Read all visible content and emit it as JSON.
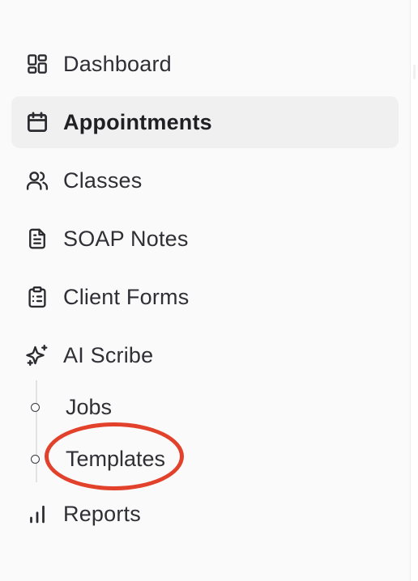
{
  "sidebar": {
    "items": [
      {
        "label": "Dashboard",
        "icon": "dashboard-icon"
      },
      {
        "label": "Appointments",
        "icon": "calendar-icon",
        "active": true
      },
      {
        "label": "Classes",
        "icon": "users-icon"
      },
      {
        "label": "SOAP Notes",
        "icon": "document-icon"
      },
      {
        "label": "Client Forms",
        "icon": "clipboard-icon"
      },
      {
        "label": "AI Scribe",
        "icon": "sparkles-icon"
      },
      {
        "label": "Reports",
        "icon": "bar-chart-icon"
      }
    ],
    "ai_scribe_children": [
      {
        "label": "Jobs"
      },
      {
        "label": "Templates"
      }
    ]
  },
  "colors": {
    "active_bg": "#f0f0f1",
    "annotation_ring": "#e2412b",
    "text": "#2f2f35"
  }
}
